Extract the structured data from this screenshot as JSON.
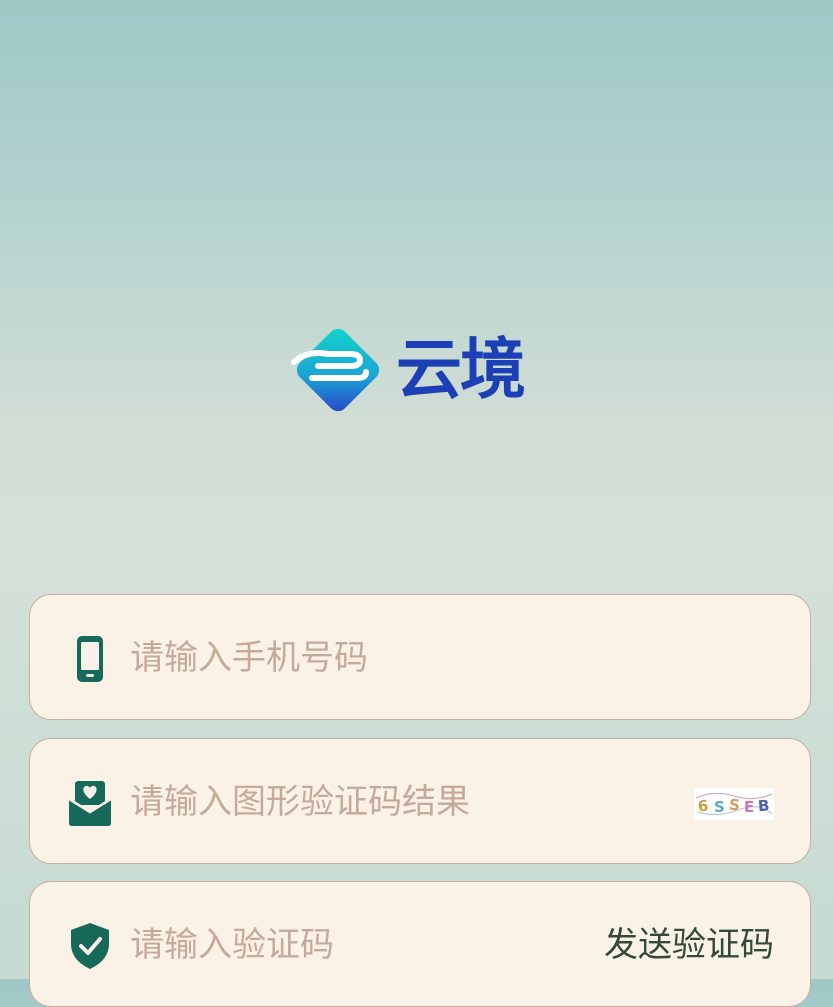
{
  "brand": {
    "name": "云境",
    "text_color": "#1d3fb5"
  },
  "colors": {
    "field_bg": "#fbf2e7",
    "field_border": "#c9aea0",
    "icon": "#17695a",
    "placeholder": "#c6a99b",
    "action_text": "#344a38"
  },
  "form": {
    "phone": {
      "icon": "phone-icon",
      "value": "",
      "placeholder": "请输入手机号码"
    },
    "captcha": {
      "icon": "mail-heart-icon",
      "value": "",
      "placeholder": "请输入图形验证码结果",
      "image_text": "6SSEB"
    },
    "sms_code": {
      "icon": "shield-check-icon",
      "value": "",
      "placeholder": "请输入验证码",
      "send_label": "发送验证码"
    }
  }
}
